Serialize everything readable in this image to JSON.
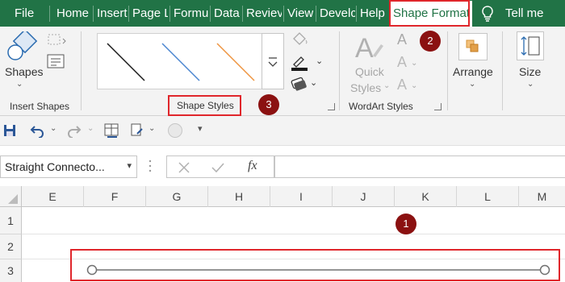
{
  "tabs": [
    {
      "label": "File"
    },
    {
      "label": "Home"
    },
    {
      "label": "Insert"
    },
    {
      "label": "Page L"
    },
    {
      "label": "Formu"
    },
    {
      "label": "Data"
    },
    {
      "label": "Reviev"
    },
    {
      "label": "View"
    },
    {
      "label": "Develc"
    },
    {
      "label": "Help"
    },
    {
      "label": "Shape Format"
    },
    {
      "label": "Tell me"
    }
  ],
  "ribbon": {
    "insert_shapes": {
      "shapes_label": "Shapes",
      "group_label": "Insert Shapes"
    },
    "shape_styles": {
      "group_label": "Shape Styles"
    },
    "wordart": {
      "quick_styles_line1": "Quick",
      "quick_styles_line2": "Styles",
      "group_label": "WordArt Styles"
    },
    "arrange_label": "Arrange",
    "size_label": "Size"
  },
  "name_box": {
    "value": "Straight Connecto..."
  },
  "formula_bar": {
    "fx": "fx",
    "value": ""
  },
  "columns": [
    "E",
    "F",
    "G",
    "H",
    "I",
    "J",
    "K",
    "L",
    "M"
  ],
  "rows": [
    "1",
    "2",
    "3"
  ],
  "markers": [
    "1",
    "2",
    "3"
  ],
  "colors": {
    "tab_bar": "#217346",
    "highlight": "#e0262b",
    "marker": "#8b1111",
    "style_black": "#1a1a1a",
    "style_blue": "#4a86d0",
    "style_orange": "#ee9440"
  }
}
